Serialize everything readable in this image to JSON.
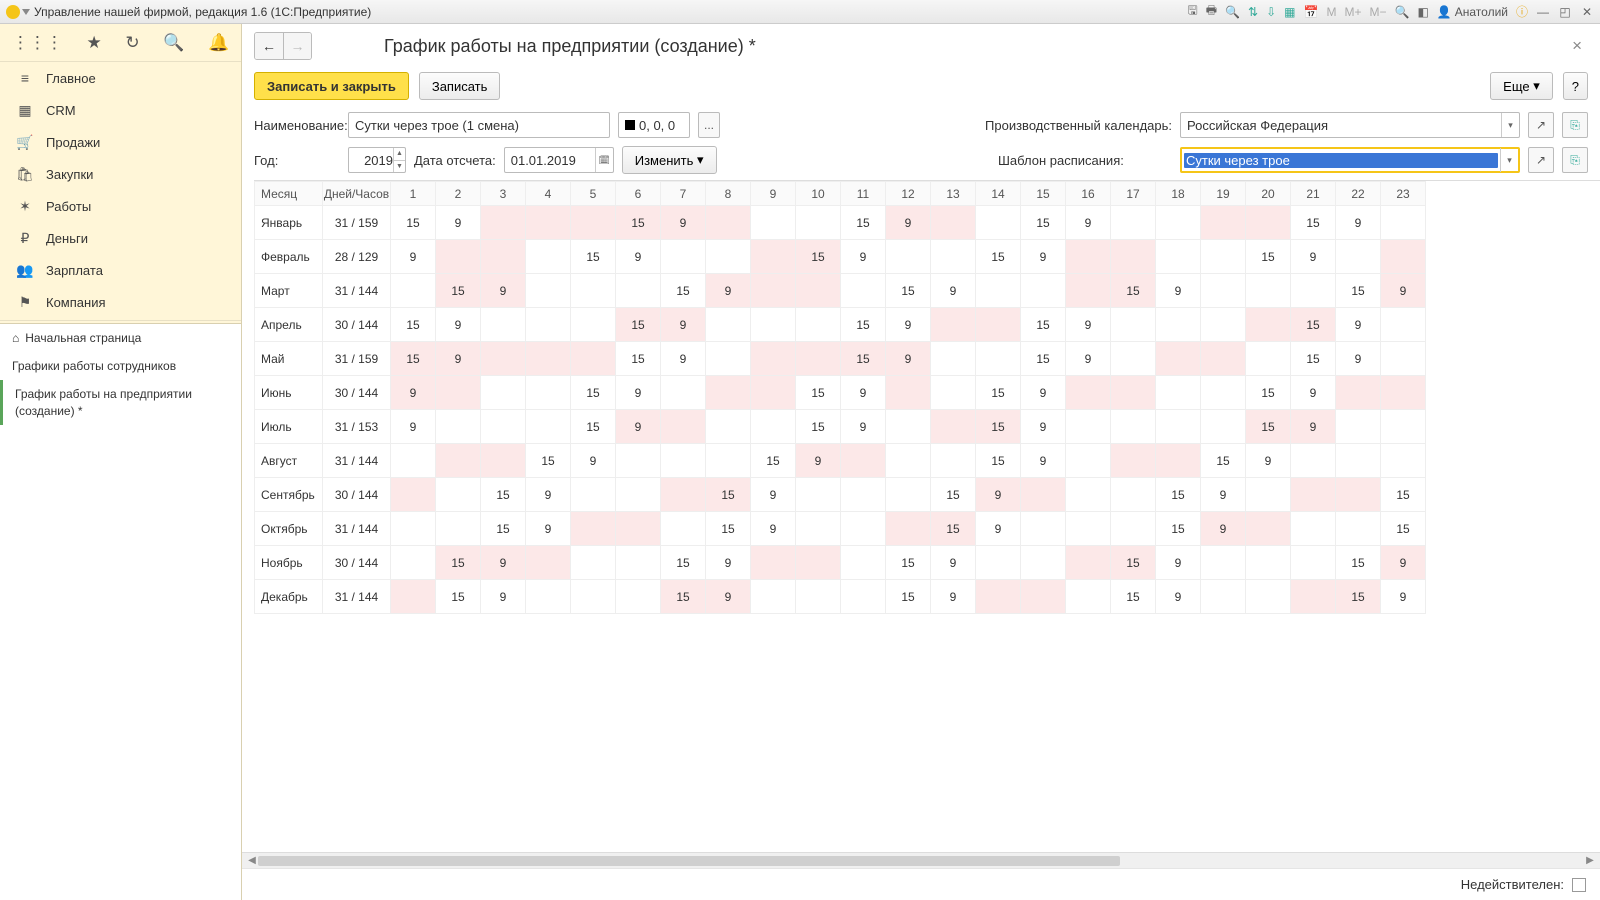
{
  "titlebar": {
    "app_title": "Управление нашей фирмой, редакция 1.6  (1С:Предприятие)",
    "user": "Анатолий"
  },
  "sidebar": {
    "items": [
      {
        "icon": "≡",
        "label": "Главное"
      },
      {
        "icon": "▦",
        "label": "CRM"
      },
      {
        "icon": "🛒",
        "label": "Продажи"
      },
      {
        "icon": "🛍",
        "label": "Закупки"
      },
      {
        "icon": "✶",
        "label": "Работы"
      },
      {
        "icon": "₽",
        "label": "Деньги"
      },
      {
        "icon": "👥",
        "label": "Зарплата"
      },
      {
        "icon": "⚑",
        "label": "Компания"
      }
    ],
    "sub": [
      {
        "icon": "⌂",
        "label": "Начальная страница"
      },
      {
        "icon": "",
        "label": "Графики работы сотрудников"
      },
      {
        "icon": "",
        "label": "График работы на предприятии (создание) *",
        "active": true
      }
    ]
  },
  "page": {
    "title": "График работы на предприятии (создание) *"
  },
  "toolbar": {
    "save_close": "Записать и закрыть",
    "save": "Записать",
    "more": "Еще",
    "help": "?"
  },
  "form": {
    "name_label": "Наименование:",
    "name_value": "Сутки через трое (1 смена)",
    "color_code": "0, 0, 0",
    "ellipsis": "...",
    "calendar_label": "Производственный календарь:",
    "calendar_value": "Российская Федерация",
    "year_label": "Год:",
    "year_value": "2019",
    "date_label": "Дата отсчета:",
    "date_value": "01.01.2019",
    "change": "Изменить",
    "template_label": "Шаблон расписания:",
    "template_value": "Сутки через трое"
  },
  "footer": {
    "inactive_label": "Недействителен:"
  },
  "table": {
    "head": {
      "month": "Месяц",
      "dh": "Дней/Часов",
      "days": [
        "1",
        "2",
        "3",
        "4",
        "5",
        "6",
        "7",
        "8",
        "9",
        "10",
        "11",
        "12",
        "13",
        "14",
        "15",
        "16",
        "17",
        "18",
        "19",
        "20",
        "21",
        "22",
        "23"
      ]
    },
    "rows": [
      {
        "month": "Январь",
        "dh": "31 / 159",
        "cells": [
          {
            "v": "15"
          },
          {
            "v": "9"
          },
          {
            "v": "",
            "p": 1
          },
          {
            "v": "",
            "p": 1
          },
          {
            "v": "",
            "p": 1
          },
          {
            "v": "15",
            "p": 1
          },
          {
            "v": "9",
            "p": 1
          },
          {
            "v": "",
            "p": 1
          },
          {
            "v": ""
          },
          {
            "v": ""
          },
          {
            "v": "15"
          },
          {
            "v": "9",
            "p": 1
          },
          {
            "v": "",
            "p": 1
          },
          {
            "v": ""
          },
          {
            "v": "15"
          },
          {
            "v": "9"
          },
          {
            "v": ""
          },
          {
            "v": ""
          },
          {
            "v": "",
            "p": 1
          },
          {
            "v": "",
            "p": 1
          },
          {
            "v": "15"
          },
          {
            "v": "9"
          },
          {
            "v": ""
          }
        ]
      },
      {
        "month": "Февраль",
        "dh": "28 / 129",
        "cells": [
          {
            "v": "9"
          },
          {
            "v": "",
            "p": 1
          },
          {
            "v": "",
            "p": 1
          },
          {
            "v": ""
          },
          {
            "v": "15"
          },
          {
            "v": "9"
          },
          {
            "v": ""
          },
          {
            "v": ""
          },
          {
            "v": "",
            "p": 1
          },
          {
            "v": "15",
            "p": 1
          },
          {
            "v": "9"
          },
          {
            "v": ""
          },
          {
            "v": ""
          },
          {
            "v": "15"
          },
          {
            "v": "9"
          },
          {
            "v": "",
            "p": 1
          },
          {
            "v": "",
            "p": 1
          },
          {
            "v": ""
          },
          {
            "v": ""
          },
          {
            "v": "15"
          },
          {
            "v": "9"
          },
          {
            "v": ""
          },
          {
            "v": "",
            "p": 1
          }
        ]
      },
      {
        "month": "Март",
        "dh": "31 / 144",
        "cells": [
          {
            "v": ""
          },
          {
            "v": "15",
            "p": 1
          },
          {
            "v": "9",
            "p": 1
          },
          {
            "v": ""
          },
          {
            "v": ""
          },
          {
            "v": ""
          },
          {
            "v": "15"
          },
          {
            "v": "9",
            "p": 1
          },
          {
            "v": "",
            "p": 1
          },
          {
            "v": "",
            "p": 1
          },
          {
            "v": ""
          },
          {
            "v": "15"
          },
          {
            "v": "9"
          },
          {
            "v": ""
          },
          {
            "v": ""
          },
          {
            "v": "",
            "p": 1
          },
          {
            "v": "15",
            "p": 1
          },
          {
            "v": "9"
          },
          {
            "v": ""
          },
          {
            "v": ""
          },
          {
            "v": ""
          },
          {
            "v": "15"
          },
          {
            "v": "9",
            "p": 1
          }
        ]
      },
      {
        "month": "Апрель",
        "dh": "30 / 144",
        "cells": [
          {
            "v": "15"
          },
          {
            "v": "9"
          },
          {
            "v": ""
          },
          {
            "v": ""
          },
          {
            "v": ""
          },
          {
            "v": "15",
            "p": 1
          },
          {
            "v": "9",
            "p": 1
          },
          {
            "v": ""
          },
          {
            "v": ""
          },
          {
            "v": ""
          },
          {
            "v": "15"
          },
          {
            "v": "9"
          },
          {
            "v": "",
            "p": 1
          },
          {
            "v": "",
            "p": 1
          },
          {
            "v": "15"
          },
          {
            "v": "9"
          },
          {
            "v": ""
          },
          {
            "v": ""
          },
          {
            "v": ""
          },
          {
            "v": "",
            "p": 1
          },
          {
            "v": "15",
            "p": 1
          },
          {
            "v": "9"
          },
          {
            "v": ""
          }
        ]
      },
      {
        "month": "Май",
        "dh": "31 / 159",
        "cells": [
          {
            "v": "15",
            "p": 1
          },
          {
            "v": "9",
            "p": 1
          },
          {
            "v": "",
            "p": 1
          },
          {
            "v": "",
            "p": 1
          },
          {
            "v": "",
            "p": 1
          },
          {
            "v": "15"
          },
          {
            "v": "9"
          },
          {
            "v": ""
          },
          {
            "v": "",
            "p": 1
          },
          {
            "v": "",
            "p": 1
          },
          {
            "v": "15",
            "p": 1
          },
          {
            "v": "9",
            "p": 1
          },
          {
            "v": ""
          },
          {
            "v": ""
          },
          {
            "v": "15"
          },
          {
            "v": "9"
          },
          {
            "v": ""
          },
          {
            "v": "",
            "p": 1
          },
          {
            "v": "",
            "p": 1
          },
          {
            "v": ""
          },
          {
            "v": "15"
          },
          {
            "v": "9"
          },
          {
            "v": ""
          }
        ]
      },
      {
        "month": "Июнь",
        "dh": "30 / 144",
        "cells": [
          {
            "v": "9",
            "p": 1
          },
          {
            "v": "",
            "p": 1
          },
          {
            "v": ""
          },
          {
            "v": ""
          },
          {
            "v": "15"
          },
          {
            "v": "9"
          },
          {
            "v": ""
          },
          {
            "v": "",
            "p": 1
          },
          {
            "v": "",
            "p": 1
          },
          {
            "v": "15"
          },
          {
            "v": "9"
          },
          {
            "v": "",
            "p": 1
          },
          {
            "v": ""
          },
          {
            "v": "15"
          },
          {
            "v": "9"
          },
          {
            "v": "",
            "p": 1
          },
          {
            "v": "",
            "p": 1
          },
          {
            "v": ""
          },
          {
            "v": ""
          },
          {
            "v": "15"
          },
          {
            "v": "9"
          },
          {
            "v": "",
            "p": 1
          },
          {
            "v": "",
            "p": 1
          }
        ]
      },
      {
        "month": "Июль",
        "dh": "31 / 153",
        "cells": [
          {
            "v": "9"
          },
          {
            "v": ""
          },
          {
            "v": ""
          },
          {
            "v": ""
          },
          {
            "v": "15"
          },
          {
            "v": "9",
            "p": 1
          },
          {
            "v": "",
            "p": 1
          },
          {
            "v": ""
          },
          {
            "v": ""
          },
          {
            "v": "15"
          },
          {
            "v": "9"
          },
          {
            "v": ""
          },
          {
            "v": "",
            "p": 1
          },
          {
            "v": "15",
            "p": 1
          },
          {
            "v": "9"
          },
          {
            "v": ""
          },
          {
            "v": ""
          },
          {
            "v": ""
          },
          {
            "v": ""
          },
          {
            "v": "15",
            "p": 1
          },
          {
            "v": "9",
            "p": 1
          },
          {
            "v": ""
          },
          {
            "v": ""
          }
        ]
      },
      {
        "month": "Август",
        "dh": "31 / 144",
        "cells": [
          {
            "v": ""
          },
          {
            "v": "",
            "p": 1
          },
          {
            "v": "",
            "p": 1
          },
          {
            "v": "15"
          },
          {
            "v": "9"
          },
          {
            "v": ""
          },
          {
            "v": ""
          },
          {
            "v": ""
          },
          {
            "v": "15"
          },
          {
            "v": "9",
            "p": 1
          },
          {
            "v": "",
            "p": 1
          },
          {
            "v": ""
          },
          {
            "v": ""
          },
          {
            "v": "15"
          },
          {
            "v": "9"
          },
          {
            "v": ""
          },
          {
            "v": "",
            "p": 1
          },
          {
            "v": "",
            "p": 1
          },
          {
            "v": "15"
          },
          {
            "v": "9"
          },
          {
            "v": ""
          },
          {
            "v": ""
          },
          {
            "v": ""
          }
        ]
      },
      {
        "month": "Сентябрь",
        "dh": "30 / 144",
        "cells": [
          {
            "v": "",
            "p": 1
          },
          {
            "v": ""
          },
          {
            "v": "15"
          },
          {
            "v": "9"
          },
          {
            "v": ""
          },
          {
            "v": ""
          },
          {
            "v": "",
            "p": 1
          },
          {
            "v": "15",
            "p": 1
          },
          {
            "v": "9"
          },
          {
            "v": ""
          },
          {
            "v": ""
          },
          {
            "v": ""
          },
          {
            "v": "15"
          },
          {
            "v": "9",
            "p": 1
          },
          {
            "v": "",
            "p": 1
          },
          {
            "v": ""
          },
          {
            "v": ""
          },
          {
            "v": "15"
          },
          {
            "v": "9"
          },
          {
            "v": ""
          },
          {
            "v": "",
            "p": 1
          },
          {
            "v": "",
            "p": 1
          },
          {
            "v": "15"
          }
        ]
      },
      {
        "month": "Октябрь",
        "dh": "31 / 144",
        "cells": [
          {
            "v": ""
          },
          {
            "v": ""
          },
          {
            "v": "15"
          },
          {
            "v": "9"
          },
          {
            "v": "",
            "p": 1
          },
          {
            "v": "",
            "p": 1
          },
          {
            "v": ""
          },
          {
            "v": "15"
          },
          {
            "v": "9"
          },
          {
            "v": ""
          },
          {
            "v": ""
          },
          {
            "v": "",
            "p": 1
          },
          {
            "v": "15",
            "p": 1
          },
          {
            "v": "9"
          },
          {
            "v": ""
          },
          {
            "v": ""
          },
          {
            "v": ""
          },
          {
            "v": "15"
          },
          {
            "v": "9",
            "p": 1
          },
          {
            "v": "",
            "p": 1
          },
          {
            "v": ""
          },
          {
            "v": ""
          },
          {
            "v": "15"
          }
        ]
      },
      {
        "month": "Ноябрь",
        "dh": "30 / 144",
        "cells": [
          {
            "v": ""
          },
          {
            "v": "15",
            "p": 1
          },
          {
            "v": "9",
            "p": 1
          },
          {
            "v": "",
            "p": 1
          },
          {
            "v": ""
          },
          {
            "v": ""
          },
          {
            "v": "15"
          },
          {
            "v": "9"
          },
          {
            "v": "",
            "p": 1
          },
          {
            "v": "",
            "p": 1
          },
          {
            "v": ""
          },
          {
            "v": "15"
          },
          {
            "v": "9"
          },
          {
            "v": ""
          },
          {
            "v": ""
          },
          {
            "v": "",
            "p": 1
          },
          {
            "v": "15",
            "p": 1
          },
          {
            "v": "9"
          },
          {
            "v": ""
          },
          {
            "v": ""
          },
          {
            "v": ""
          },
          {
            "v": "15"
          },
          {
            "v": "9",
            "p": 1
          }
        ]
      },
      {
        "month": "Декабрь",
        "dh": "31 / 144",
        "cells": [
          {
            "v": "",
            "p": 1
          },
          {
            "v": "15"
          },
          {
            "v": "9"
          },
          {
            "v": ""
          },
          {
            "v": ""
          },
          {
            "v": ""
          },
          {
            "v": "15",
            "p": 1
          },
          {
            "v": "9",
            "p": 1
          },
          {
            "v": ""
          },
          {
            "v": ""
          },
          {
            "v": ""
          },
          {
            "v": "15"
          },
          {
            "v": "9"
          },
          {
            "v": "",
            "p": 1
          },
          {
            "v": "",
            "p": 1
          },
          {
            "v": ""
          },
          {
            "v": "15"
          },
          {
            "v": "9"
          },
          {
            "v": ""
          },
          {
            "v": ""
          },
          {
            "v": "",
            "p": 1
          },
          {
            "v": "15",
            "p": 1
          },
          {
            "v": "9"
          }
        ]
      }
    ]
  }
}
